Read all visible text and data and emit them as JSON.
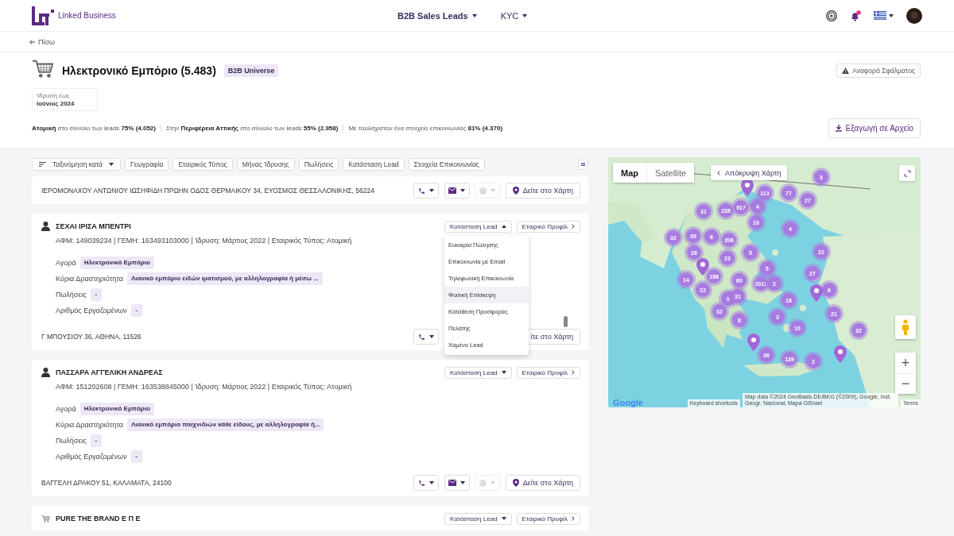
{
  "header": {
    "brand": "Linked Business",
    "nav": [
      {
        "label": "B2B Sales Leads",
        "selected": true
      },
      {
        "label": "KYC",
        "selected": false
      }
    ]
  },
  "back": "Πίσω",
  "summary": {
    "title": "Ηλεκτρονικό Εμπόριο (5.483)",
    "badge": "B2B Universe",
    "report_button": "Αναφορά Σφάλματος",
    "date_filter": {
      "label": "Ίδρυση έως",
      "value": "Ιούνιος 2024"
    },
    "stats": [
      "**Ατομική** στο σύνολο των leads **75% (4.052)**",
      "Στην **Περιφέρεια Αττικής** στο σύνολο των leads **55% (2.958)**",
      "Με τουλάχιστον ένα στοιχείο επικοινωνίας **81% (4.370)**"
    ],
    "export_button": "Εξαγωγή σε Αρχείο"
  },
  "toolbar": {
    "sort": "Ταξινόμηση κατά",
    "filters": [
      "Γεωγραφία",
      "Εταιρικός Τύπος",
      "Μήνας Ίδρυσης",
      "Πωλήσεις",
      "Κατάσταση Lead",
      "Στοιχεία Επικοινωνίας"
    ]
  },
  "leads": [
    {
      "address": "ΙΕΡΟΜΟΝΑΧΟΥ ΑΝΤΩΝΙΟΥ ΙΩΣΗΦΙΔΗ ΠΡΩΗΝ ΟΔΟΣ ΘΕΡΜΑΙΚΟΥ 34, ΕΥΟΣΜΟΣ ΘΕΣΣΑΛΟΝΙΚΗΣ, 56224",
      "actions": [
        {
          "kind": "phone"
        },
        {
          "kind": "email"
        },
        {
          "kind": "status"
        },
        {
          "kind": "map",
          "label": "Δείτε στο Χάρτη",
          "icon": true
        }
      ]
    },
    {
      "kind": "person",
      "name": "ΣΕΧΑΙ ΙΡΙΣΑ ΜΠΕΝΤΡΙ",
      "status_button": "Κατάσταση Lead",
      "status_open": true,
      "profile_button": "Εταιρικό Προφίλ",
      "info": "ΑΦΜ: 149039234 | ΓΕΜΗ: 163493103000 | Ίδρυση: Μάρτιος 2022 | Εταιρικός Τύπος: Ατομική",
      "fields": [
        {
          "name": "Αγορά",
          "value": "Ηλεκτρονικό Εμπόριο"
        },
        {
          "name": "Κύρια Δραστηριότητα",
          "value": "Λιανικό εμπόριο ειδών ιματισμού, με αλληλογραφία ή μέσω ..."
        },
        {
          "name": "Πωλήσεις",
          "value": "-"
        },
        {
          "name": "Αριθμός Εργαζομένων",
          "value": "-"
        }
      ],
      "address": "Γ ΜΠΟΥΣΙΟΥ 36, ΑΘΗΝΑ, 11526",
      "actions": [
        {
          "kind": "phone"
        },
        {
          "kind": "map",
          "label": "ίτε στο Χάρτη"
        }
      ],
      "menu": [
        {
          "label": "Ευκαιρία Πώλησης",
          "hovered": false
        },
        {
          "label": "Επικοινωνία με Email",
          "hovered": false
        },
        {
          "label": "Τηλεφωνική Επικοινωνία",
          "hovered": false
        },
        {
          "label": "Φυσική Επίσκεψη",
          "hovered": true
        },
        {
          "label": "Κατάθεση Προσφοράς",
          "hovered": false
        },
        {
          "label": "Πελάτης",
          "hovered": false
        },
        {
          "label": "Χαμένο Lead",
          "hovered": false
        }
      ]
    },
    {
      "kind": "person",
      "name": "ΠΑΣΣΑΡΑ ΑΓΓΕΛΙΚΗ ΑΝΔΡΕΑΣ",
      "status_button": "Κατάσταση Lead",
      "status_open": false,
      "profile_button": "Εταιρικό Προφίλ",
      "info": "ΑΦΜ: 151202608 | ΓΕΜΗ: 163538845000 | Ίδρυση: Μάρτιος 2022 | Εταιρικός Τύπος: Ατομική",
      "fields": [
        {
          "name": "Αγορά",
          "value": "Ηλεκτρονικό Εμπόριο"
        },
        {
          "name": "Κύρια Δραστηριότητα",
          "value": "Λιανικό εμπόριο παιχνιδιών κάθε είδους, με αλληλογραφία ή..."
        },
        {
          "name": "Πωλήσεις",
          "value": "-"
        },
        {
          "name": "Αριθμός Εργαζομένων",
          "value": "-"
        }
      ],
      "address": "ΒΑΓΓΕΛΗ ΔΡΑΚΟΥ 51, ΚΑΛΑΜΑΤΑ, 24100",
      "actions": [
        {
          "kind": "phone"
        },
        {
          "kind": "email"
        },
        {
          "kind": "status"
        },
        {
          "kind": "map",
          "label": "Δείτε στο Χάρτη",
          "icon": true
        }
      ]
    },
    {
      "kind": "cart",
      "name": "PURE THE BRAND Ε Π Ε",
      "status_button": "Κατάσταση Lead",
      "status_open": false,
      "profile_button": "Εταιρικό Προφίλ"
    }
  ],
  "map": {
    "view_toggle": [
      {
        "label": "Map",
        "selected": true
      },
      {
        "label": "Satellite",
        "selected": false
      }
    ],
    "hide_button": "Απόκρυψη Χάρτη",
    "markers": [
      {
        "kind": "cluster",
        "count": "3"
      },
      {
        "kind": "cluster",
        "count": "113"
      },
      {
        "kind": "cluster",
        "count": "77"
      },
      {
        "kind": "cluster",
        "count": "27"
      },
      {
        "kind": "cluster",
        "count": "31"
      },
      {
        "kind": "cluster",
        "count": "238"
      },
      {
        "kind": "cluster",
        "count": "917"
      },
      {
        "kind": "cluster",
        "count": "4"
      },
      {
        "kind": "cluster",
        "count": "10"
      },
      {
        "kind": "cluster",
        "count": "4"
      },
      {
        "kind": "cluster",
        "count": "32"
      },
      {
        "kind": "cluster",
        "count": "39"
      },
      {
        "kind": "cluster",
        "count": "6"
      },
      {
        "kind": "cluster",
        "count": "206"
      },
      {
        "kind": "cluster",
        "count": "26"
      },
      {
        "kind": "cluster",
        "count": "5"
      },
      {
        "kind": "cluster",
        "count": "23"
      },
      {
        "kind": "cluster",
        "count": "22"
      },
      {
        "kind": "cluster",
        "count": "5"
      },
      {
        "kind": "cluster",
        "count": "27"
      },
      {
        "kind": "cluster",
        "count": "14"
      },
      {
        "kind": "cluster",
        "count": "198"
      },
      {
        "kind": "cluster",
        "count": "60"
      },
      {
        "kind": "cluster",
        "count": "2011"
      },
      {
        "kind": "cluster",
        "count": "2"
      },
      {
        "kind": "cluster",
        "count": "22"
      },
      {
        "kind": "cluster",
        "count": "9"
      },
      {
        "kind": "cluster",
        "count": "31"
      },
      {
        "kind": "cluster",
        "count": "18"
      },
      {
        "kind": "cluster",
        "count": "6"
      },
      {
        "kind": "cluster",
        "count": "21"
      },
      {
        "kind": "cluster",
        "count": "32"
      },
      {
        "kind": "cluster",
        "count": "8"
      },
      {
        "kind": "cluster",
        "count": "3"
      },
      {
        "kind": "cluster",
        "count": "10"
      },
      {
        "kind": "cluster",
        "count": "32"
      },
      {
        "kind": "cluster",
        "count": "36"
      },
      {
        "kind": "cluster",
        "count": "139"
      },
      {
        "kind": "cluster",
        "count": "2"
      },
      {
        "kind": "pin"
      },
      {
        "kind": "pin"
      },
      {
        "kind": "pin"
      },
      {
        "kind": "pin"
      },
      {
        "kind": "pin"
      }
    ],
    "zoom_in": "+",
    "zoom_out": "−",
    "logo": "Google",
    "shortcuts": "Keyboard shortcuts",
    "attribution": "Map data ©2024 GeoBasis-DE/BKG (©2009), Google, Inst. Geogr. Nacional, Mapa GISrael",
    "terms": "Terms"
  }
}
